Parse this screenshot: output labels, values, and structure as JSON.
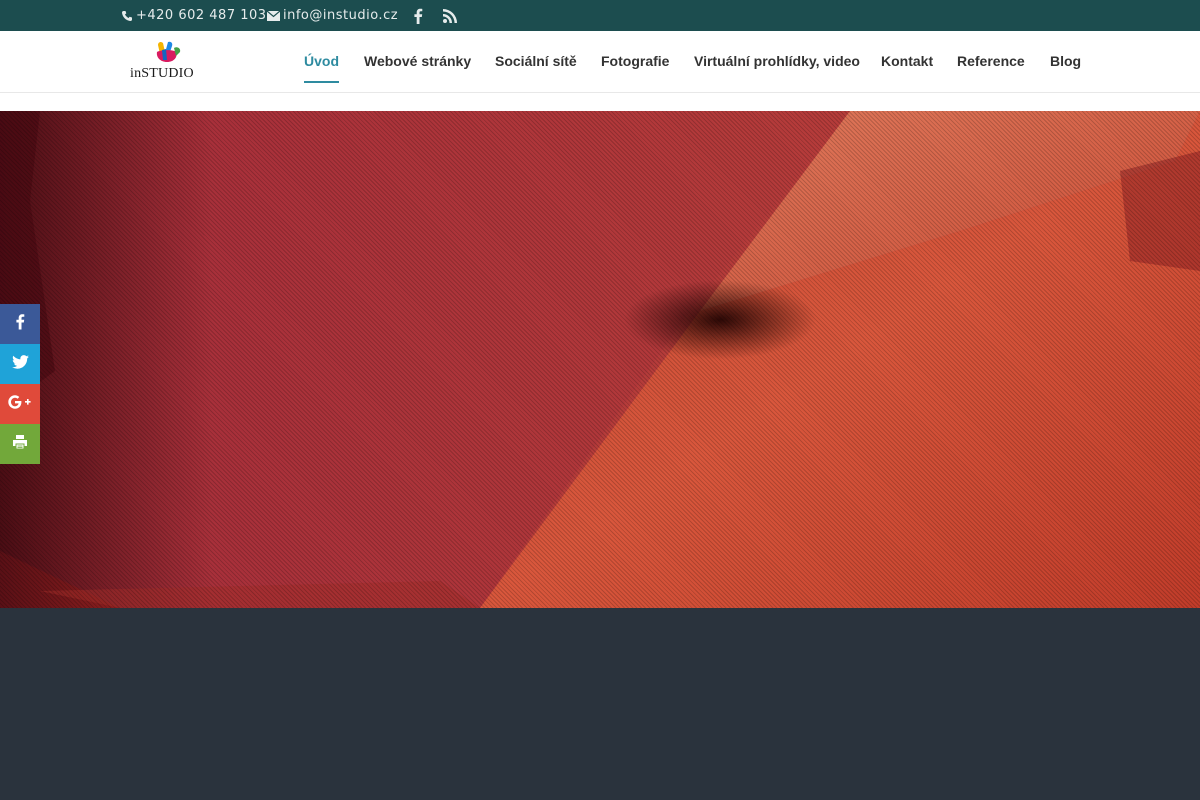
{
  "topbar": {
    "phone": "+420 602 487 103",
    "email": "info@instudio.cz",
    "icons": [
      "phone-icon",
      "mail-icon",
      "facebook-icon",
      "rss-icon"
    ]
  },
  "header": {
    "logo_text": "inSTUDIO",
    "nav": [
      {
        "label": "Úvod",
        "active": true
      },
      {
        "label": "Webové stránky"
      },
      {
        "label": "Sociální sítě"
      },
      {
        "label": "Fotografie"
      },
      {
        "label": "Virtuální prohlídky, video"
      },
      {
        "label": "Kontakt"
      },
      {
        "label": "Reference"
      },
      {
        "label": "Blog"
      }
    ]
  },
  "share": [
    "facebook",
    "twitter",
    "google-plus",
    "print"
  ],
  "colors": {
    "topbar": "#1c4d4f",
    "accent": "#2e8ba0",
    "hero": "#c2493a",
    "footer": "#2a333d"
  }
}
